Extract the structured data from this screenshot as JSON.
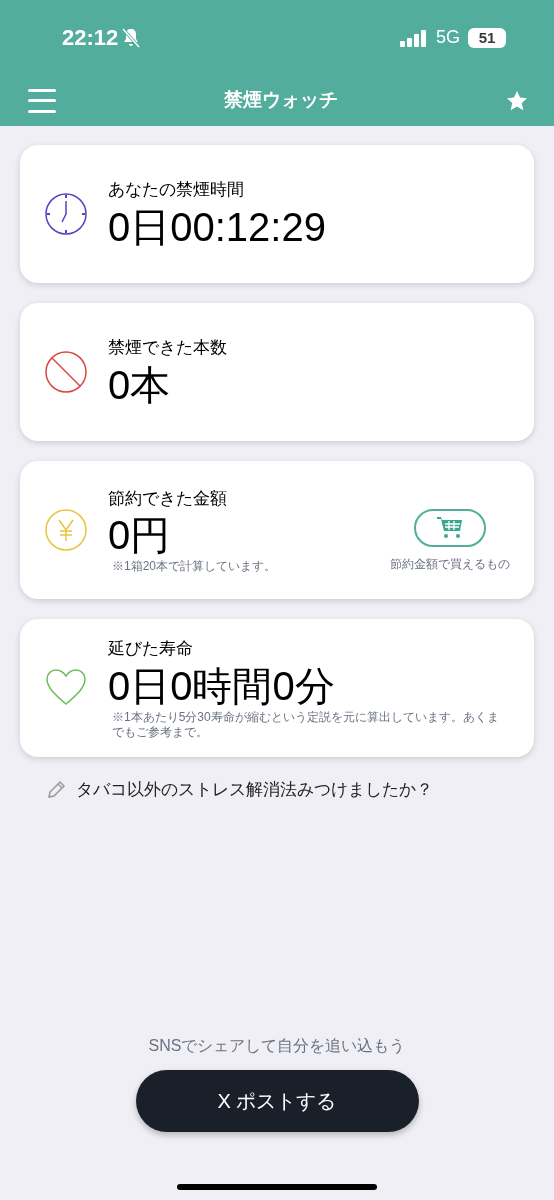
{
  "status_bar": {
    "time": "22:12",
    "network": "5G",
    "battery": "51"
  },
  "header": {
    "title": "禁煙ウォッチ"
  },
  "cards": [
    {
      "kind": "time",
      "color": "#5a3fc0",
      "label": "あなたの禁煙時間",
      "value": "0日00:12:29"
    },
    {
      "kind": "count",
      "color": "#d9473f",
      "label": "禁煙できた本数",
      "value": "0本"
    },
    {
      "kind": "money",
      "color": "#e8c440",
      "label": "節約できた金額",
      "value": "0円",
      "note": "※1箱20本で計算しています。",
      "action": {
        "caption": "節約金額で買えるもの"
      }
    },
    {
      "kind": "life",
      "color": "#6cbf5a",
      "label": "延びた寿命",
      "value": "0日0時間0分",
      "note": "※1本あたり5分30寿命が縮むという定説を元に算出しています。あくまでもご参考まで。"
    }
  ],
  "prompt": "タバコ以外のストレス解消法みつけましたか？",
  "share": {
    "hint": "SNSでシェアして自分を追い込もう",
    "button": "X ポストする"
  }
}
